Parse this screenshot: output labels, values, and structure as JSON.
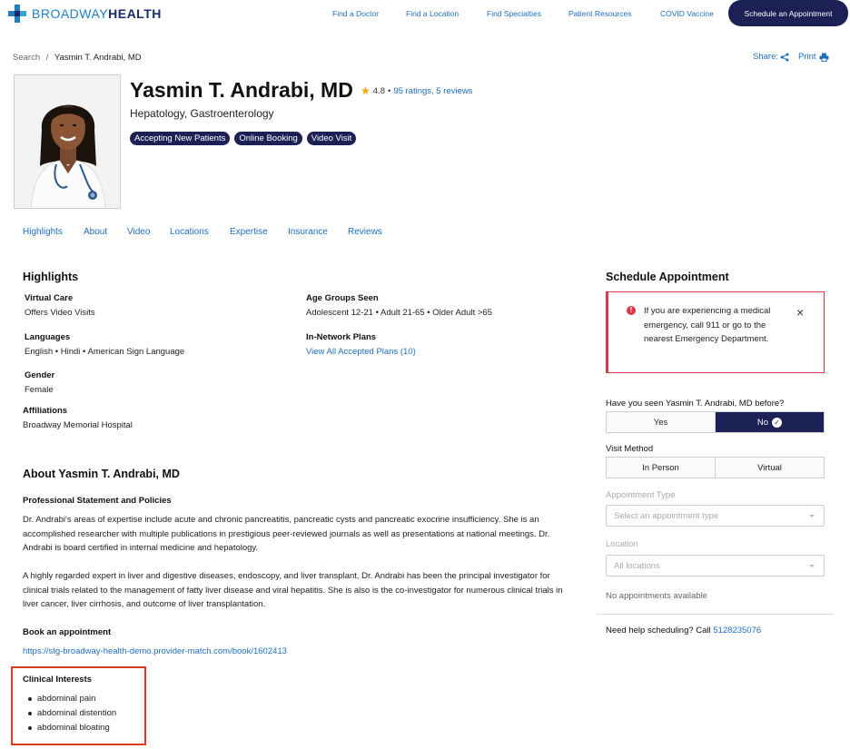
{
  "brand": {
    "light": "BROADWAY",
    "bold": "HEALTH",
    "color": "#1b2a6b"
  },
  "nav": {
    "links": [
      "Find a Doctor",
      "Find a Location",
      "Find Specialties",
      "Patient Resources",
      "COVID Vaccine"
    ],
    "cta": "Schedule an Appointment"
  },
  "breadcrumb": {
    "root": "Search",
    "separator": "/",
    "current": "Yasmin T. Andrabi, MD"
  },
  "actions": {
    "share": "Share:",
    "print": "Print"
  },
  "profile": {
    "name": "Yasmin T. Andrabi, MD",
    "rating": "4.8",
    "rating_sep": "•",
    "ratings_link": "95 ratings, 5 reviews",
    "specialty": "Hepatology, Gastroenterology",
    "badges": [
      "Accepting New Patients",
      "Online Booking",
      "Video Visit"
    ]
  },
  "tabs": [
    "Highlights",
    "About",
    "Video",
    "Locations",
    "Expertise",
    "Insurance",
    "Reviews"
  ],
  "highlights": {
    "title": "Highlights",
    "virtual_care": {
      "label": "Virtual Care",
      "value": "Offers Video Visits"
    },
    "languages": {
      "label": "Languages",
      "value": "English • Hindi • American Sign Language"
    },
    "gender": {
      "label": "Gender",
      "value": "Female"
    },
    "affiliations": {
      "label": "Affiliations",
      "value": "Broadway Memorial Hospital"
    },
    "age_groups": {
      "label": "Age Groups Seen",
      "value": "Adolescent 12-21 • Adult 21-65 • Older Adult >65"
    },
    "plans": {
      "label": "In-Network Plans",
      "link": "View All Accepted Plans (10)"
    }
  },
  "about": {
    "title": "About Yasmin T. Andrabi, MD",
    "statement_title": "Professional Statement and Policies",
    "p1": "Dr. Andrabi's areas of expertise include acute and chronic pancreatitis, pancreatic cysts and pancreatic exocrine insufficiency. She is an accomplished researcher with multiple publications in prestigious peer-reviewed journals as well as presentations at national meetings. Dr. Andrabi is board certified in internal medicine and hepatology.",
    "p2": "A highly regarded expert in liver and digestive diseases, endoscopy, and liver transplant, Dr. Andrabi has been the principal investigator for clinical trials related to the management of fatty liver disease and viral hepatitis. She is also is the co-investigator for numerous clinical trials in liver cancer, liver cirrhosis, and outcome of liver transplantation.",
    "book_title": "Book an appointment",
    "book_link": "https://stg-broadway-health-demo.provider-match.com/book/1602413",
    "interests_title": "Clinical Interests",
    "interests": [
      "abdominal pain",
      "abdominal distention",
      "abdominal bloating"
    ]
  },
  "schedule": {
    "title": "Schedule Appointment",
    "alert": "If you are experiencing a medical emergency, call 911 or go to the nearest Emergency Department.",
    "alert_icon": "!",
    "alert_close": "×",
    "seen_question": "Have you seen Yasmin T. Andrabi, MD before?",
    "seen_options": [
      "Yes",
      "No"
    ],
    "seen_selected": "No",
    "visit_label": "Visit Method",
    "visit_options": [
      "In Person",
      "Virtual"
    ],
    "appt_type_label": "Appointment Type",
    "appt_type_placeholder": "Select an appointment type",
    "location_label": "Location",
    "location_placeholder": "All locations",
    "no_appointments": "No appointments available",
    "help_text": "Need help scheduling? Call",
    "help_phone": "5128235076"
  }
}
